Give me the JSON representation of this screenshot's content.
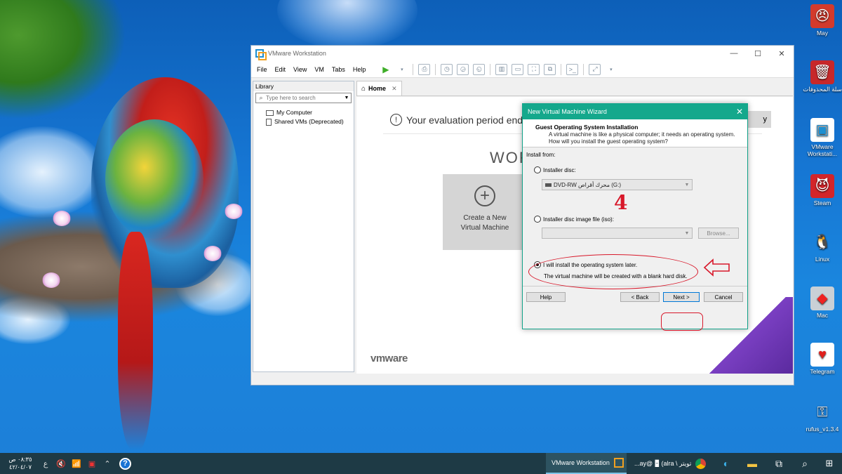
{
  "desktop": {
    "icons": [
      {
        "label": "May",
        "glyph": "😠",
        "color": "#d33a2c"
      },
      {
        "label": "سلة المحذوفات",
        "glyph": "🗑",
        "color": "#c7282a"
      },
      {
        "label": "VMware Workstati...",
        "glyph": "▣",
        "color": "#1e8fd0"
      },
      {
        "label": "Steam",
        "glyph": "😈",
        "color": "#d3252a"
      },
      {
        "label": "Linux",
        "glyph": "🐧",
        "color": "#ffffff"
      },
      {
        "label": "Mac",
        "glyph": "◆",
        "color": "#ccd2d8"
      },
      {
        "label": "Telegram",
        "glyph": "♥",
        "color": "#ffffff"
      },
      {
        "label": "rufus_v1.3.4",
        "glyph": "⚿",
        "color": "#dddddd"
      }
    ]
  },
  "vmware": {
    "title": "VMware Workstation",
    "window_controls": {
      "minimize": "—",
      "maximize": "☐",
      "close": "✕"
    },
    "menu": [
      "File",
      "Edit",
      "View",
      "VM",
      "Tabs",
      "Help"
    ],
    "library": {
      "header": "Library",
      "search_placeholder": "Type here to search",
      "items": [
        "My Computer",
        "Shared VMs (Deprecated)"
      ]
    },
    "tab": {
      "label": "Home",
      "close": "✕"
    },
    "home": {
      "eval_text": "Your evaluation period ends i",
      "buy_text": "y",
      "heading": "WOR",
      "create_line1": "Create a New",
      "create_line2": "Virtual Machine",
      "logo": "vmware"
    }
  },
  "wizard": {
    "title": "New Virtual Machine Wizard",
    "close": "✕",
    "heading": "Guest Operating System Installation",
    "description": "A virtual machine is like a physical computer; it needs an operating system. How will you install the guest operating system?",
    "install_from": "Install from:",
    "option_disc": "Installer disc:",
    "disc_value": "DVD-RW محرك أقراص (G:)",
    "option_iso": "Installer disc image file (iso):",
    "iso_value": "",
    "browse": "Browse...",
    "option_later": "I will install the operating system later.",
    "later_description": "The virtual machine will be created with a blank hard disk.",
    "selected_option": "later",
    "buttons": {
      "help": "Help",
      "back": "< Back",
      "next": "Next >",
      "cancel": "Cancel"
    }
  },
  "annotation": {
    "step_number": "4",
    "color": "#d8182a"
  },
  "taskbar": {
    "clock_time": "٠٨:٣٥ ص",
    "clock_date": "٤٢/٠٤/٠٧",
    "lang": "ع",
    "active_app": "VMware Workstation",
    "browser_tab": "...ay@ 🁢 (alra \\ تويتر"
  }
}
